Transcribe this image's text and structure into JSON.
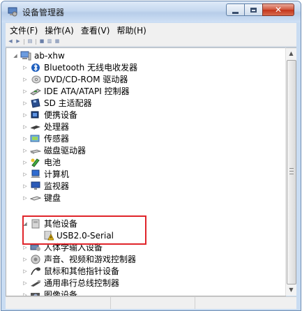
{
  "window": {
    "title": "设备管理器"
  },
  "menu": [
    {
      "label": "文件(F)"
    },
    {
      "label": "操作(A)"
    },
    {
      "label": "查看(V)"
    },
    {
      "label": "帮助(H)"
    }
  ],
  "tree": {
    "root": "ab-xhw",
    "items": [
      {
        "label": "Bluetooth 无线电收发器",
        "icon": "bluetooth-icon"
      },
      {
        "label": "DVD/CD-ROM 驱动器",
        "icon": "dvd-drive-icon"
      },
      {
        "label": "IDE ATA/ATAPI 控制器",
        "icon": "ide-controller-icon"
      },
      {
        "label": "SD 主适配器",
        "icon": "sd-adapter-icon"
      },
      {
        "label": "便携设备",
        "icon": "portable-device-icon"
      },
      {
        "label": "处理器",
        "icon": "processor-icon"
      },
      {
        "label": "传感器",
        "icon": "sensor-icon"
      },
      {
        "label": "磁盘驱动器",
        "icon": "disk-drive-icon"
      },
      {
        "label": "电池",
        "icon": "battery-icon"
      },
      {
        "label": "计算机",
        "icon": "computer-icon"
      },
      {
        "label": "监视器",
        "icon": "monitor-icon"
      },
      {
        "label": "键盘",
        "icon": "keyboard-icon"
      },
      {
        "label": "其他设备",
        "icon": "other-devices-icon",
        "expanded": true
      },
      {
        "label": "USB2.0-Serial",
        "icon": "unknown-device-warning-icon",
        "child": true
      },
      {
        "label": "人体学输入设备",
        "icon": "hid-icon"
      },
      {
        "label": "声音、视频和游戏控制器",
        "icon": "sound-icon"
      },
      {
        "label": "鼠标和其他指针设备",
        "icon": "mouse-icon"
      },
      {
        "label": "通用串行总线控制器",
        "icon": "usb-controller-icon"
      },
      {
        "label": "图像设备",
        "icon": "imaging-device-icon"
      }
    ]
  },
  "colors": {
    "highlight": "#e0242a",
    "titlebar": "#c5d8ef"
  }
}
